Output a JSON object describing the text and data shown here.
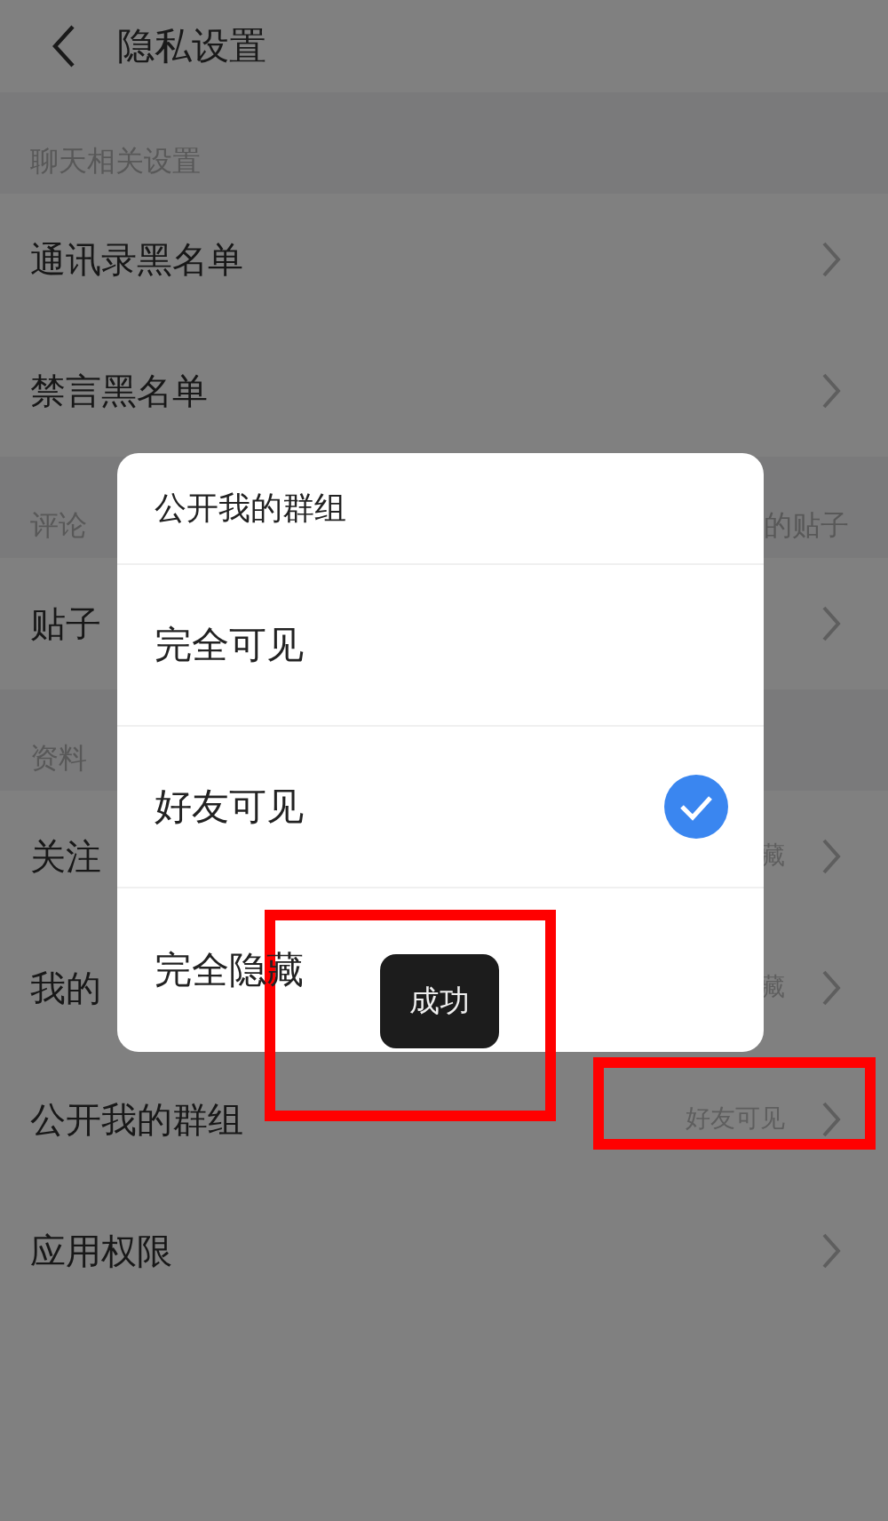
{
  "header": {
    "title": "隐私设置"
  },
  "sections": [
    {
      "title": "聊天相关设置",
      "items": [
        {
          "label": "通讯录黑名单"
        },
        {
          "label": "禁言黑名单"
        }
      ]
    },
    {
      "title": "评论",
      "title_right": "的贴子",
      "items": [
        {
          "label": "贴子"
        }
      ]
    },
    {
      "title": "资料",
      "items": [
        {
          "label": "关注",
          "value": "藏"
        },
        {
          "label": "我的",
          "value": "藏"
        },
        {
          "label": "公开我的群组",
          "value": "好友可见"
        },
        {
          "label": "应用权限"
        }
      ]
    }
  ],
  "dialog": {
    "title": "公开我的群组",
    "options": [
      {
        "label": "完全可见",
        "selected": false
      },
      {
        "label": "好友可见",
        "selected": true
      },
      {
        "label": "完全隐藏",
        "selected": false
      }
    ]
  },
  "toast": "成功"
}
